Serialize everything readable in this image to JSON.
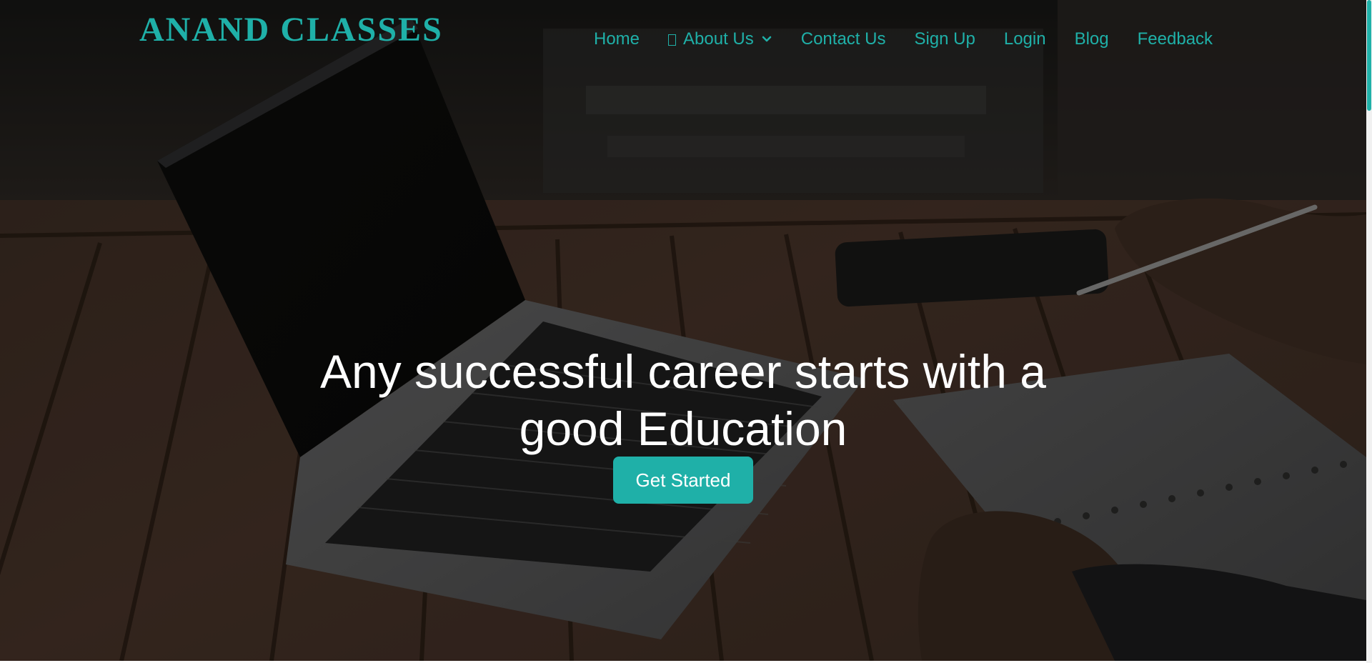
{
  "brand": {
    "name": "ANAND CLASSES",
    "color": "#1fb0a8"
  },
  "nav": {
    "items": [
      {
        "label": "Home"
      },
      {
        "label": "About Us",
        "icon": "missing-glyph-icon",
        "has_dropdown": true
      },
      {
        "label": "Contact Us"
      },
      {
        "label": "Sign Up"
      },
      {
        "label": "Login"
      },
      {
        "label": "Blog"
      },
      {
        "label": "Feedback"
      }
    ]
  },
  "hero": {
    "headline_line1": "Any successful career starts with a",
    "headline_line2": "good Education",
    "cta_label": "Get Started",
    "background": "laptop-on-wooden-table-photo"
  },
  "colors": {
    "accent": "#1fb0a8",
    "headline": "#ffffff"
  }
}
